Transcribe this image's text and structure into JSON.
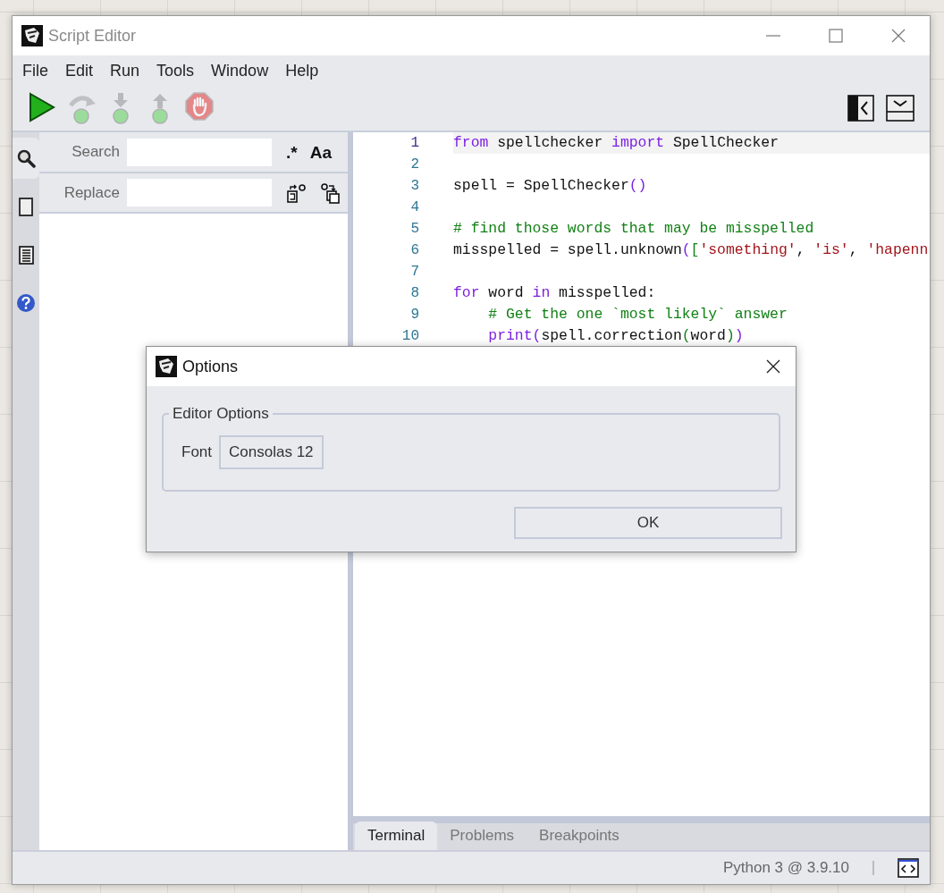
{
  "window": {
    "title": "Script Editor"
  },
  "menu": [
    "File",
    "Edit",
    "Run",
    "Tools",
    "Window",
    "Help"
  ],
  "toolbar": [
    {
      "kind": "run",
      "disabled": false
    },
    {
      "kind": "step_over",
      "disabled": true
    },
    {
      "kind": "step_into",
      "disabled": true
    },
    {
      "kind": "step_out",
      "disabled": true
    },
    {
      "kind": "stop",
      "disabled": true
    }
  ],
  "side_tabs": [
    {
      "kind": "search",
      "selected": true
    },
    {
      "kind": "page",
      "selected": false
    },
    {
      "kind": "list",
      "selected": false
    },
    {
      "kind": "help",
      "selected": false
    }
  ],
  "search_panel": {
    "search_label": "Search",
    "toggles": [
      ".*",
      "Aa"
    ],
    "replace_label": "Replace"
  },
  "editor": {
    "lines": [
      {
        "number": "1",
        "current": true,
        "tokens": [
          {
            "kind": "keyword",
            "text": "from"
          },
          {
            "kind": "plain",
            "text": " spellchecker "
          },
          {
            "kind": "keyword",
            "text": "import"
          },
          {
            "kind": "plain",
            "text": " SpellChecker"
          }
        ]
      },
      {
        "number": "2",
        "current": false
      },
      {
        "number": "3",
        "current": false,
        "tokens": [
          {
            "kind": "plain",
            "text": "spell = SpellChecker"
          },
          {
            "kind": "bracket1",
            "text": "()"
          }
        ]
      },
      {
        "number": "4",
        "current": false
      },
      {
        "number": "5",
        "current": false,
        "tokens": [
          {
            "kind": "comment",
            "text": "# find those words that may be misspelled"
          }
        ]
      },
      {
        "number": "6",
        "current": false,
        "tokens": [
          {
            "kind": "plain",
            "text": "misspelled = spell.unknown"
          },
          {
            "kind": "bracket1",
            "text": "("
          },
          {
            "kind": "bracket2",
            "text": "["
          },
          {
            "kind": "string",
            "text": "'something'"
          },
          {
            "kind": "plain",
            "text": ", "
          },
          {
            "kind": "string",
            "text": "'is'"
          },
          {
            "kind": "plain",
            "text": ", "
          },
          {
            "kind": "string",
            "text": "'hapenn"
          }
        ]
      },
      {
        "number": "7",
        "current": false
      },
      {
        "number": "8",
        "current": false,
        "tokens": [
          {
            "kind": "keyword",
            "text": "for"
          },
          {
            "kind": "plain",
            "text": " word "
          },
          {
            "kind": "keyword",
            "text": "in"
          },
          {
            "kind": "plain",
            "text": " misspelled:"
          }
        ]
      },
      {
        "number": "9",
        "current": false,
        "tokens": [
          {
            "kind": "comment",
            "text": "    # Get the one `most likely` answer"
          }
        ]
      },
      {
        "number": "10",
        "current": false,
        "tokens": [
          {
            "kind": "keyword",
            "text": "    print"
          },
          {
            "kind": "bracket1",
            "text": "("
          },
          {
            "kind": "plain",
            "text": "spell.correction"
          },
          {
            "kind": "bracket2",
            "text": "("
          },
          {
            "kind": "plain",
            "text": "word"
          },
          {
            "kind": "bracket2",
            "text": ")"
          },
          {
            "kind": "bracket1",
            "text": ")"
          }
        ]
      }
    ]
  },
  "bottom_tabs": [
    {
      "label": "Terminal",
      "selected": true
    },
    {
      "label": "Problems",
      "selected": false
    },
    {
      "label": "Breakpoints",
      "selected": false
    }
  ],
  "status_bar": {
    "interpreter": "Python 3 @ 3.9.10"
  },
  "dialog": {
    "title": "Options",
    "group": "Editor Options",
    "font_label": "Font",
    "font_value": "Consolas 12",
    "ok": "OK"
  }
}
